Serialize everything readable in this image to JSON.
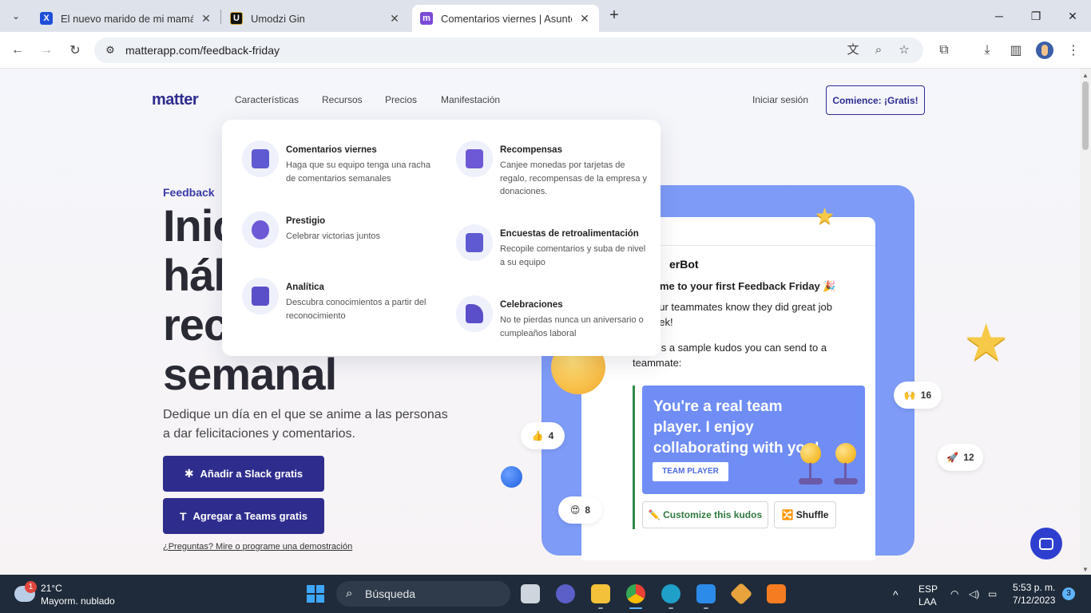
{
  "browser": {
    "tabs": [
      {
        "title": "El nuevo marido de mi mamá e",
        "icon": "x-logo-icon",
        "favicon_color": "#1d4ed8",
        "favicon_glyph": "X"
      },
      {
        "title": "Umodzi Gin",
        "icon": "umodzi-logo-icon",
        "favicon_color": "#111111",
        "favicon_glyph": "U"
      },
      {
        "title": "Comentarios viernes | Asunto",
        "icon": "matter-logo-icon",
        "favicon_color": "#7b4bd6",
        "favicon_glyph": "m",
        "active": true
      }
    ],
    "new_tab_glyph": "+",
    "close_glyph": "✕",
    "url": "matterapp.com/feedback-friday",
    "window_controls": [
      "─",
      "❐",
      "✕"
    ]
  },
  "site": {
    "logo": "matter",
    "nav": [
      "Características",
      "Recursos",
      "Precios",
      "Manifestación"
    ],
    "login": "Iniciar sesión",
    "cta": "Comience: ¡Gratis!",
    "dropdown": {
      "left_column": [
        {
          "title": "Comentarios viernes",
          "desc": "Haga que su equipo tenga una racha de comentarios semanales",
          "icon": "calendar-icon",
          "color": "#5f5ad1"
        },
        {
          "title": "Prestigio",
          "desc": "Celebrar victorias juntos",
          "icon": "heart-handshake-icon",
          "color": "#6d59d6"
        },
        {
          "title": "Analítica",
          "desc": "Descubra conocimientos a partir del reconocimiento",
          "icon": "chart-icon",
          "color": "#5a4fc9"
        }
      ],
      "right_column": [
        {
          "title": "Recompensas",
          "desc": "Canjee monedas por tarjetas de regalo, recompensas de la empresa y donaciones.",
          "icon": "gift-icon",
          "color": "#6d59d6"
        },
        {
          "title": "Encuestas de retroalimentación",
          "desc": "Recopile comentarios y suba de nivel a su equipo",
          "icon": "survey-icon",
          "color": "#5f5ad1"
        },
        {
          "title": "Celebraciones",
          "desc": "No te pierdas nunca un aniversario o cumpleaños laboral",
          "icon": "party-popper-icon",
          "color": "#5a4fc9"
        }
      ]
    },
    "hero": {
      "eyebrow": "Feedback",
      "headline_lines": [
        "Inic",
        "hál",
        "rec",
        "semanal"
      ],
      "subtitle": "Dedique un día en el que se anime a las personas a dar felicitaciones y comentarios.",
      "slack_button": "Añadir a Slack gratis",
      "teams_button": "Agregar a Teams gratis",
      "demo_link": "¿Preguntas? Mire o programe una demostración"
    },
    "illustration": {
      "bot_name": "erBot",
      "line1": "ome to your first Feedback Friday 🎉",
      "line2a": "our teammates know they did great job",
      "line2b": "eek!",
      "line3a": "e's a sample kudos you can send to a",
      "line3b": "teammate:",
      "kudos_text": "You're a real team player. I enjoy collaborating with you!",
      "badge": "TEAM PLAYER",
      "customize": "✏️ Customize this kudos",
      "shuffle": "🔀 Shuffle",
      "reactions": [
        {
          "emoji": "🙌",
          "count": "16"
        },
        {
          "emoji": "👍",
          "count": "4"
        },
        {
          "emoji": "🚀",
          "count": "12"
        },
        {
          "emoji": "😍",
          "count": "8"
        }
      ]
    }
  },
  "taskbar": {
    "weather_badge": "1",
    "temperature": "21°C",
    "weather": "Mayorm. nublado",
    "search_placeholder": "Búsqueda",
    "language": "ESP",
    "layout": "LAA",
    "time": "5:53 p. m.",
    "date": "7/12/2023",
    "notifications": "3",
    "tray_chevron": "^",
    "apps": [
      {
        "name": "task-view",
        "color": "#cfd5dd"
      },
      {
        "name": "meet",
        "color": "#5b5fc7"
      },
      {
        "name": "file-explorer",
        "color": "#f3c13a"
      },
      {
        "name": "chrome",
        "color": "#e94235"
      },
      {
        "name": "edge",
        "color": "#1fa0c9"
      },
      {
        "name": "vscode",
        "color": "#2c8ae8"
      },
      {
        "name": "git-tool",
        "color": "#e8a33d"
      },
      {
        "name": "xampp",
        "color": "#f57c20"
      }
    ]
  }
}
